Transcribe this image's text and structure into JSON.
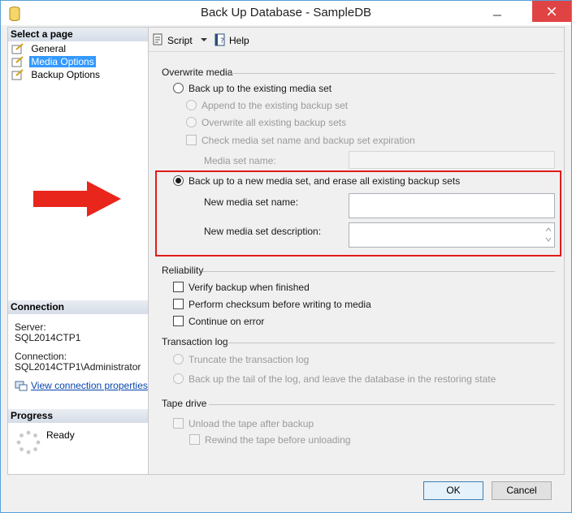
{
  "window": {
    "title": "Back Up Database - SampleDB"
  },
  "left": {
    "select_page_header": "Select a page",
    "pages": [
      {
        "label": "General",
        "selected": false
      },
      {
        "label": "Media Options",
        "selected": true
      },
      {
        "label": "Backup Options",
        "selected": false
      }
    ],
    "connection_header": "Connection",
    "server_label": "Server:",
    "server_value": "SQL2014CTP1",
    "connection_label": "Connection:",
    "connection_value": "SQL2014CTP1\\Administrator",
    "view_connection_link": "View connection properties",
    "progress_header": "Progress",
    "progress_status": "Ready"
  },
  "toolbar": {
    "script_label": "Script",
    "help_label": "Help"
  },
  "overwrite": {
    "group_title": "Overwrite media",
    "existing_set_label": "Back up to the existing media set",
    "append_label": "Append to the existing backup set",
    "overwrite_all_label": "Overwrite all existing backup sets",
    "check_expiration_label": "Check media set name and backup set expiration",
    "media_set_name_label": "Media set name:",
    "new_set_label": "Back up to a new media set, and erase all existing backup sets",
    "new_name_label": "New media set name:",
    "new_name_value": "",
    "new_desc_label": "New media set description:",
    "new_desc_value": ""
  },
  "reliability": {
    "group_title": "Reliability",
    "verify_label": "Verify backup when finished",
    "checksum_label": "Perform checksum before writing to media",
    "continue_label": "Continue on error"
  },
  "transaction_log": {
    "group_title": "Transaction log",
    "truncate_label": "Truncate the transaction log",
    "tail_label": "Back up the tail of the log, and leave the database in the restoring state"
  },
  "tape": {
    "group_title": "Tape drive",
    "unload_label": "Unload the tape after backup",
    "rewind_label": "Rewind the tape before unloading"
  },
  "buttons": {
    "ok": "OK",
    "cancel": "Cancel"
  },
  "colors": {
    "highlight_border": "#e11b1b",
    "arrow": "#e8261c",
    "link": "#0645ad",
    "selection": "#3399ff"
  }
}
